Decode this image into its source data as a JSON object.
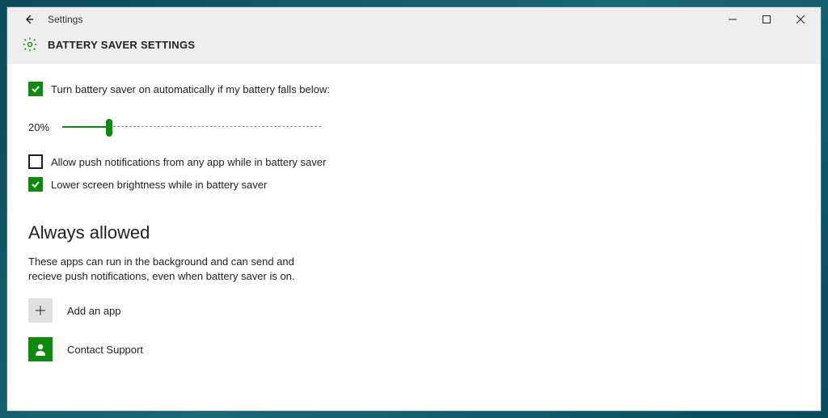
{
  "window": {
    "app_name": "Settings"
  },
  "header": {
    "page_title": "BATTERY SAVER SETTINGS"
  },
  "settings": {
    "auto_enable": {
      "label": "Turn battery saver on automatically if my battery falls below:",
      "checked": true
    },
    "threshold": {
      "value_text": "20%",
      "percent": 20
    },
    "allow_push": {
      "label": "Allow push notifications from any app while in battery saver",
      "checked": false
    },
    "lower_brightness": {
      "label": "Lower screen brightness while in battery saver",
      "checked": true
    }
  },
  "always_allowed": {
    "heading": "Always allowed",
    "description": "These apps can run in the background and can send and recieve push notifications, even when battery saver is on.",
    "add_label": "Add an app",
    "items": [
      {
        "label": "Contact Support",
        "icon": "contact"
      }
    ]
  }
}
